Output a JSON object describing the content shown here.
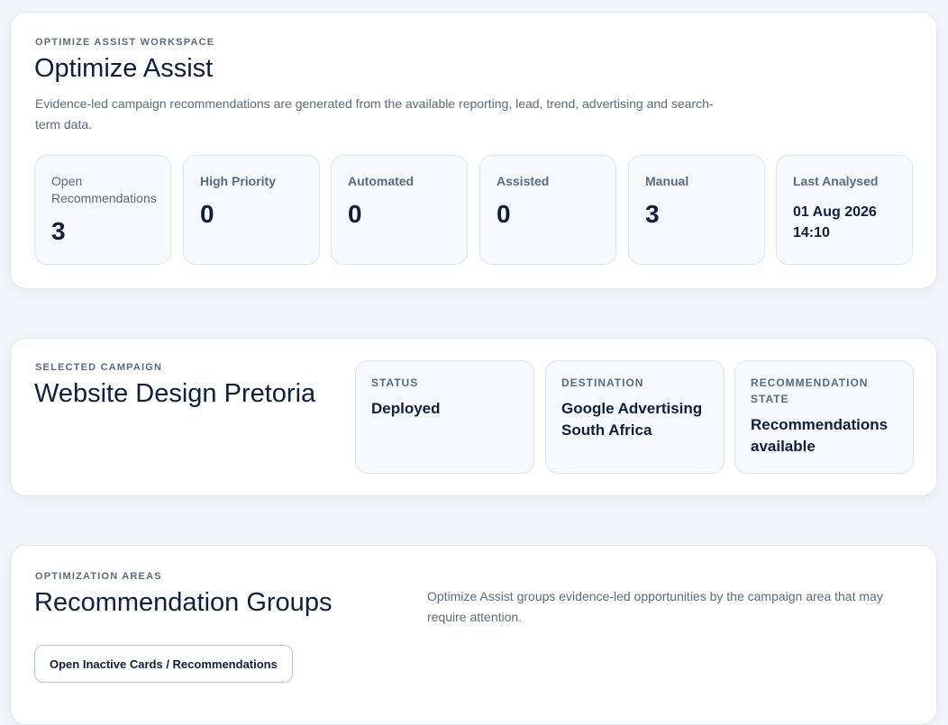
{
  "workspace": {
    "eyebrow": "OPTIMIZE ASSIST WORKSPACE",
    "title": "Optimize Assist",
    "description": "Evidence-led campaign recommendations are generated from the available reporting, lead, trend, advertising and search-term data.",
    "stats": [
      {
        "label": "Open Recommendations",
        "value": "3"
      },
      {
        "label": "High Priority",
        "value": "0"
      },
      {
        "label": "Automated",
        "value": "0"
      },
      {
        "label": "Assisted",
        "value": "0"
      },
      {
        "label": "Manual",
        "value": "3"
      },
      {
        "label": "Last Analysed",
        "value_line1": "01 Aug 2026",
        "value_line2": "14:10"
      }
    ]
  },
  "campaign": {
    "eyebrow": "SELECTED CAMPAIGN",
    "title": "Website Design Pretoria",
    "status_label": "STATUS",
    "status_value": "Deployed",
    "destination_label": "DESTINATION",
    "destination_value": "Google Advertising South Africa",
    "rec_state_label": "RECOMMENDATION STATE",
    "rec_state_value": "Recommendations available"
  },
  "groups": {
    "eyebrow": "OPTIMIZATION AREAS",
    "title": "Recommendation Groups",
    "description": "Optimize Assist groups evidence-led opportunities by the campaign area that may require attention.",
    "inactive_button_label": "Open Inactive Cards / Recommendations"
  },
  "colors": {
    "page_background": "#f2f5f9",
    "card_background": "#ffffff",
    "tile_background": "#f6f9fd",
    "heading": "#0f1f3d",
    "muted_text": "#5e6b7e"
  }
}
